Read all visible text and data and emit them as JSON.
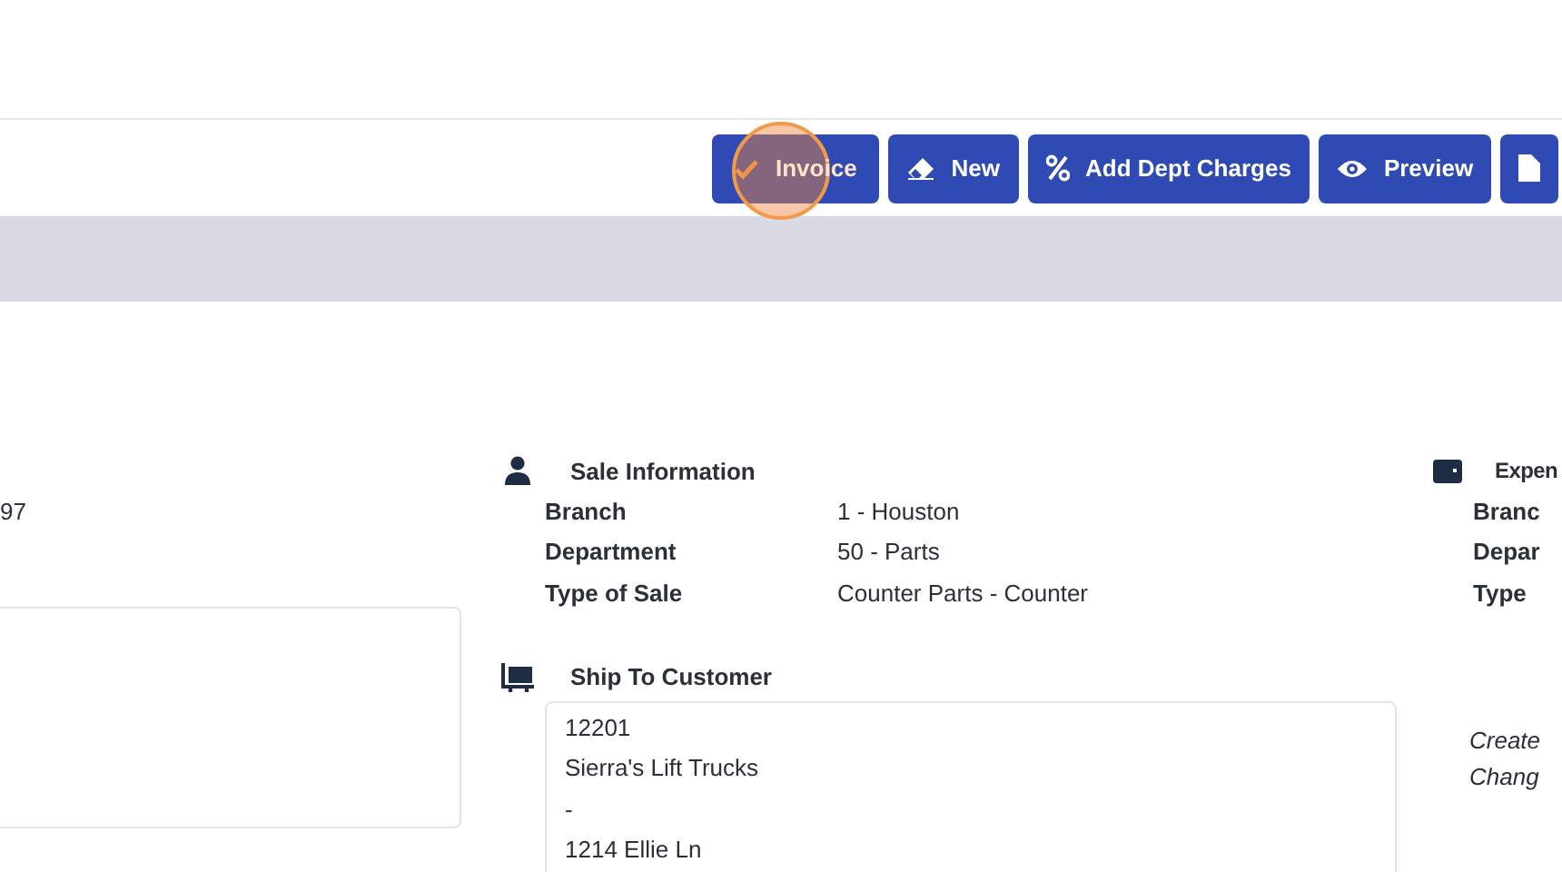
{
  "toolbar": {
    "buttons": [
      {
        "label": "Invoice",
        "kind": "check"
      },
      {
        "label": "New",
        "kind": "eraser"
      },
      {
        "label": "Add Dept Charges",
        "kind": "percent"
      },
      {
        "label": "Preview",
        "kind": "eye"
      },
      {
        "kind": "file"
      }
    ]
  },
  "left_column": {
    "values": [
      "97"
    ]
  },
  "sale_information": {
    "title": "Sale Information",
    "rows": [
      {
        "label": "Branch",
        "value": "1 - Houston"
      },
      {
        "label": "Department",
        "value": "50 - Parts"
      },
      {
        "label": "Type of Sale",
        "value": "Counter Parts - Counter"
      }
    ]
  },
  "ship_to_customer": {
    "title": "Ship To Customer",
    "lines": [
      "12201",
      "Sierra's Lift Trucks",
      "-",
      "1214 Ellie Ln"
    ]
  },
  "expense_column": {
    "title": "Expen",
    "labels": [
      "Branc",
      "Depar",
      "Type"
    ],
    "notes": [
      "Create",
      "Chang"
    ]
  }
}
